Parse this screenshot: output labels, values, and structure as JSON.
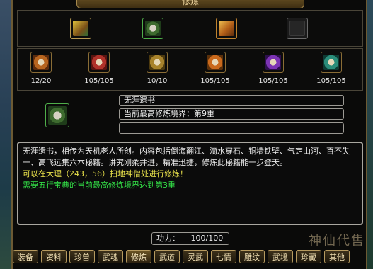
{
  "window": {
    "title": "修炼"
  },
  "top_slots": [
    {
      "icon": "book-yellow-icon"
    },
    {
      "icon": "scroll-green-icon"
    },
    {
      "icon": "book-gold-icon"
    },
    {
      "icon": "empty-slot-icon"
    }
  ],
  "skill_slots": [
    {
      "icon": "scroll-orange-icon",
      "value": "12/20"
    },
    {
      "icon": "scroll-red-icon",
      "value": "105/105"
    },
    {
      "icon": "scroll-gold-icon",
      "value": "10/10"
    },
    {
      "icon": "scroll-amber-icon",
      "value": "105/105"
    },
    {
      "icon": "scroll-purple-icon",
      "value": "105/105"
    },
    {
      "icon": "scroll-teal-icon",
      "value": "105/105"
    }
  ],
  "selected": {
    "icon": "scroll-green-icon",
    "name": "无涯遗书",
    "level_text": "当前最高修炼境界：第9重",
    "extra_text": ""
  },
  "description": {
    "line1": "无涯遗书，相传为天机老人所创。内容包括倒海翻江、滴水穿石、铜墙铁壁、气定山河、百不失一、高飞远集六本秘籍。讲究刚柔并进，精准迅捷，修炼此秘籍能一步登天。",
    "line2": "可以在大理（243，56）扫地神僧处进行修炼！",
    "line3": "需要五行宝典的当前最高修炼境界达到第3重"
  },
  "power": {
    "label": "功力：",
    "value": "100/100"
  },
  "tabs": [
    "装备",
    "资料",
    "珍兽",
    "武魂",
    "修炼",
    "武道",
    "灵武",
    "七情",
    "雕纹",
    "武境",
    "珍藏",
    "其他"
  ],
  "active_tab": "修炼",
  "watermark": "神仙代售",
  "colors": {
    "text_yellow": "#e9e14b",
    "text_green": "#33e047",
    "border_gold": "#b69a5f"
  }
}
